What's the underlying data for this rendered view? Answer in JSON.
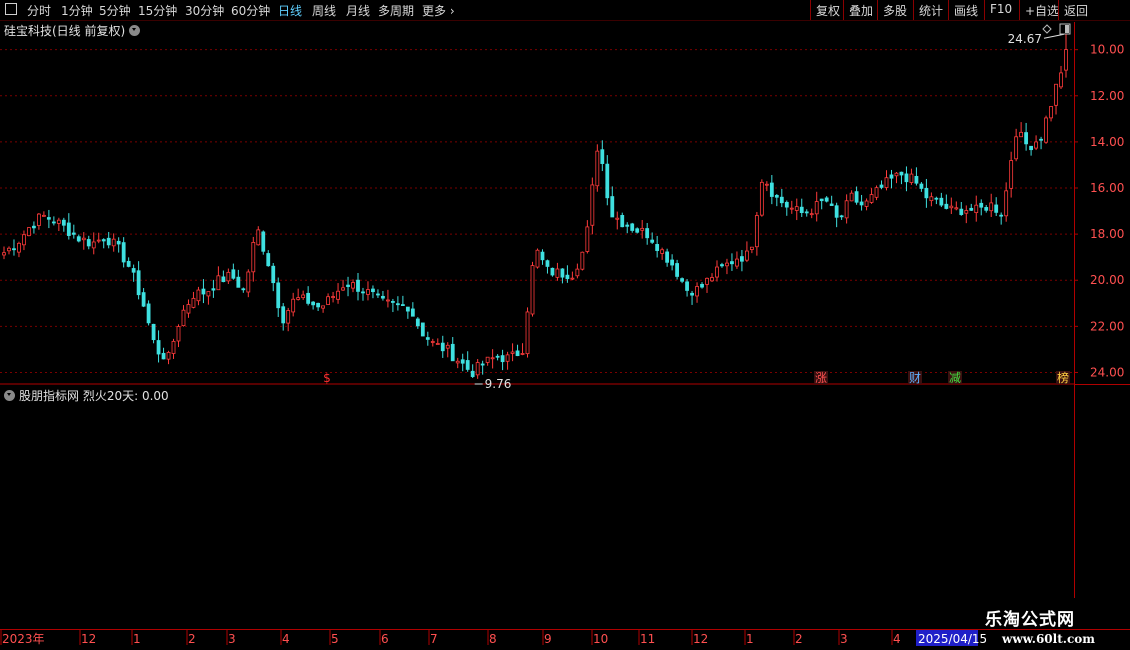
{
  "toolbar": {
    "periods": [
      "分时",
      "1分钟",
      "5分钟",
      "15分钟",
      "30分钟",
      "60分钟",
      "日线",
      "周线",
      "月线",
      "多周期",
      "更多"
    ],
    "active_period": "日线",
    "right_buttons": [
      "复权",
      "叠加",
      "多股",
      "统计",
      "画线",
      "F10",
      "+自选",
      "返回"
    ]
  },
  "main_chart": {
    "title": "硅宝科技(日线 前复权)",
    "price_labels": [
      "24.00",
      "22.00",
      "20.00",
      "18.00",
      "16.00",
      "14.00",
      "12.00",
      "10.00"
    ],
    "high_annotation": "24.67",
    "low_annotation": "9.76",
    "event_markers": [
      {
        "label": "$",
        "color": "#ff3030"
      },
      {
        "label": "涨",
        "color": "#ff5050"
      },
      {
        "label": "财",
        "color": "#5fb0ff"
      },
      {
        "label": "减",
        "color": "#40e040"
      },
      {
        "label": "榜",
        "color": "#ffd040"
      }
    ]
  },
  "indicator": {
    "title": "股朋指标网 烈火20天: 0.00"
  },
  "x_axis": {
    "labels": [
      "2023年",
      "12",
      "1",
      "2",
      "3",
      "4",
      "5",
      "6",
      "7",
      "8",
      "9",
      "10",
      "11",
      "12",
      "1",
      "2",
      "3",
      "4"
    ],
    "cursor_date": "2025/04/15"
  },
  "watermark": {
    "name": "乐淘公式网",
    "url": "www.60lt.com"
  },
  "chart_data": {
    "type": "candlestick",
    "y_range": [
      9.5,
      25.2
    ],
    "price_ticks": [
      10,
      12,
      14,
      16,
      18,
      20,
      22,
      24
    ],
    "high_point": 24.67,
    "low_point": 9.76,
    "close_path": [
      15.2,
      15.6,
      16.3,
      16.8,
      16.6,
      16.2,
      15.8,
      15.6,
      15.9,
      15.4,
      14.5,
      13.0,
      11.0,
      10.6,
      12.5,
      13.4,
      13.5,
      14.0,
      14.2,
      13.5,
      16.3,
      14.6,
      12.3,
      13.2,
      13.1,
      12.8,
      13.3,
      13.9,
      13.7,
      13.4,
      13.0,
      12.9,
      12.9,
      11.8,
      11.2,
      11.0,
      10.5,
      10.0,
      10.4,
      10.7,
      10.6,
      11.0,
      15.4,
      14.4,
      14.3,
      14.3,
      15.5,
      20.1,
      16.9,
      16.5,
      16.2,
      16.0,
      15.3,
      14.6,
      13.6,
      13.6,
      14.2,
      14.6,
      15.0,
      15.1,
      18.6,
      17.6,
      17.2,
      16.9,
      17.1,
      17.5,
      16.5,
      17.6,
      17.2,
      17.8,
      18.3,
      18.6,
      18.3,
      17.6,
      17.3,
      17.0,
      17.1,
      17.0,
      17.3,
      16.9,
      20.5,
      19.8,
      20.2,
      22.0,
      23.8
    ]
  }
}
